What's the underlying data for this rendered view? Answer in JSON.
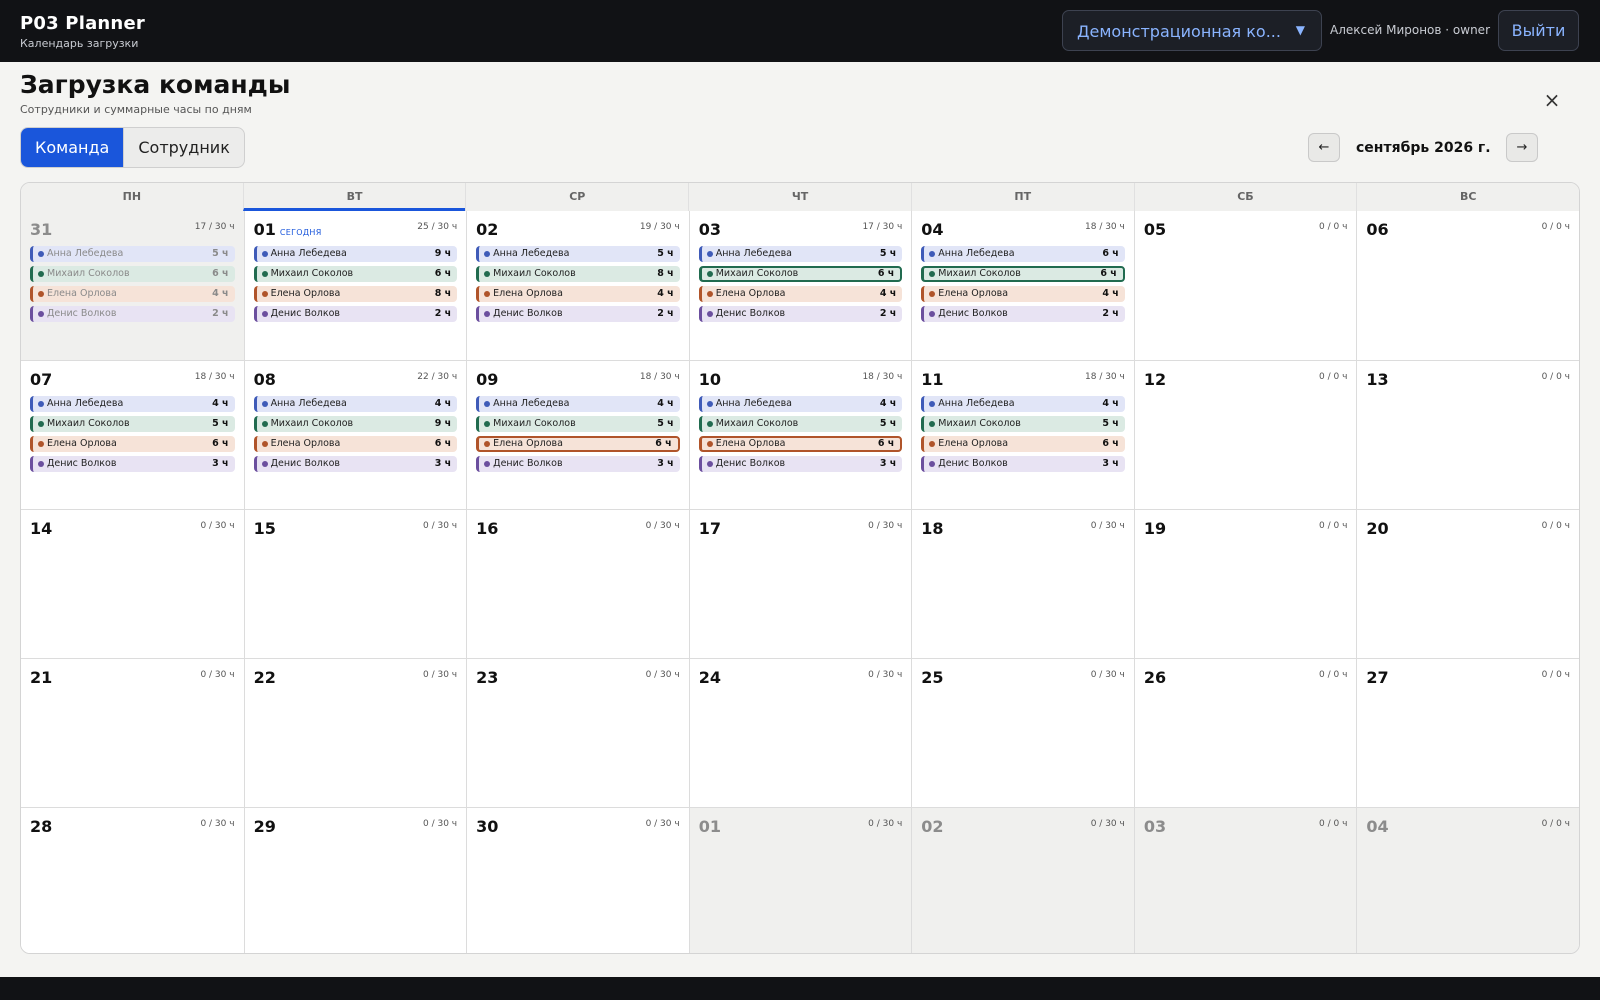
{
  "app": {
    "title": "P03 Planner",
    "subtitle": "Календарь загрузки"
  },
  "header": {
    "team_select": "Демонстрационная ко...",
    "user": "Алексей Миронов · owner",
    "logout": "Выйти"
  },
  "page": {
    "title": "Загрузка команды",
    "subtitle": "Сотрудники и суммарные часы по дням",
    "close": "×"
  },
  "view_toggle": [
    "Команда",
    "Сотрудник"
  ],
  "nav": {
    "prev": "←",
    "next": "→",
    "month": "сентябрь 2026 г."
  },
  "weekdays": [
    "ПН",
    "ВТ",
    "СР",
    "ЧТ",
    "ПТ",
    "СБ",
    "ВС"
  ],
  "today_label": "СЕГОДНЯ",
  "colors": {
    "accent": "#1a56db",
    "anna": "#3f5bb8",
    "mikhail": "#216b4f",
    "elena": "#b0542a",
    "denis": "#6b4f9e"
  },
  "people": [
    "Анна Лебедева",
    "Михаил Соколов",
    "Елена Орлова",
    "Денис Волков"
  ],
  "days": [
    {
      "num": "31",
      "hours": "17 / 30 ч",
      "out": true,
      "a": [
        {
          "p": 0,
          "h": "5 ч"
        },
        {
          "p": 1,
          "h": "6 ч"
        },
        {
          "p": 2,
          "h": "4 ч"
        },
        {
          "p": 3,
          "h": "2 ч"
        }
      ]
    },
    {
      "num": "01",
      "hours": "25 / 30 ч",
      "today": true,
      "a": [
        {
          "p": 0,
          "h": "9 ч"
        },
        {
          "p": 1,
          "h": "6 ч"
        },
        {
          "p": 2,
          "h": "8 ч"
        },
        {
          "p": 3,
          "h": "2 ч"
        }
      ]
    },
    {
      "num": "02",
      "hours": "19 / 30 ч",
      "a": [
        {
          "p": 0,
          "h": "5 ч"
        },
        {
          "p": 1,
          "h": "8 ч"
        },
        {
          "p": 2,
          "h": "4 ч"
        },
        {
          "p": 3,
          "h": "2 ч"
        }
      ]
    },
    {
      "num": "03",
      "hours": "17 / 30 ч",
      "a": [
        {
          "p": 0,
          "h": "5 ч"
        },
        {
          "p": 1,
          "h": "6 ч",
          "hl": true
        },
        {
          "p": 2,
          "h": "4 ч"
        },
        {
          "p": 3,
          "h": "2 ч"
        }
      ]
    },
    {
      "num": "04",
      "hours": "18 / 30 ч",
      "a": [
        {
          "p": 0,
          "h": "6 ч"
        },
        {
          "p": 1,
          "h": "6 ч",
          "hl": true
        },
        {
          "p": 2,
          "h": "4 ч"
        },
        {
          "p": 3,
          "h": "2 ч"
        }
      ]
    },
    {
      "num": "05",
      "hours": "0 / 0 ч",
      "a": []
    },
    {
      "num": "06",
      "hours": "0 / 0 ч",
      "a": []
    },
    {
      "num": "07",
      "hours": "18 / 30 ч",
      "a": [
        {
          "p": 0,
          "h": "4 ч"
        },
        {
          "p": 1,
          "h": "5 ч"
        },
        {
          "p": 2,
          "h": "6 ч"
        },
        {
          "p": 3,
          "h": "3 ч"
        }
      ]
    },
    {
      "num": "08",
      "hours": "22 / 30 ч",
      "a": [
        {
          "p": 0,
          "h": "4 ч"
        },
        {
          "p": 1,
          "h": "9 ч"
        },
        {
          "p": 2,
          "h": "6 ч"
        },
        {
          "p": 3,
          "h": "3 ч"
        }
      ]
    },
    {
      "num": "09",
      "hours": "18 / 30 ч",
      "a": [
        {
          "p": 0,
          "h": "4 ч"
        },
        {
          "p": 1,
          "h": "5 ч"
        },
        {
          "p": 2,
          "h": "6 ч",
          "hl": true
        },
        {
          "p": 3,
          "h": "3 ч"
        }
      ]
    },
    {
      "num": "10",
      "hours": "18 / 30 ч",
      "a": [
        {
          "p": 0,
          "h": "4 ч"
        },
        {
          "p": 1,
          "h": "5 ч"
        },
        {
          "p": 2,
          "h": "6 ч",
          "hl": true
        },
        {
          "p": 3,
          "h": "3 ч"
        }
      ]
    },
    {
      "num": "11",
      "hours": "18 / 30 ч",
      "a": [
        {
          "p": 0,
          "h": "4 ч"
        },
        {
          "p": 1,
          "h": "5 ч"
        },
        {
          "p": 2,
          "h": "6 ч"
        },
        {
          "p": 3,
          "h": "3 ч"
        }
      ]
    },
    {
      "num": "12",
      "hours": "0 / 0 ч",
      "a": []
    },
    {
      "num": "13",
      "hours": "0 / 0 ч",
      "a": []
    },
    {
      "num": "14",
      "hours": "0 / 30 ч",
      "a": []
    },
    {
      "num": "15",
      "hours": "0 / 30 ч",
      "a": []
    },
    {
      "num": "16",
      "hours": "0 / 30 ч",
      "a": []
    },
    {
      "num": "17",
      "hours": "0 / 30 ч",
      "a": []
    },
    {
      "num": "18",
      "hours": "0 / 30 ч",
      "a": []
    },
    {
      "num": "19",
      "hours": "0 / 0 ч",
      "a": []
    },
    {
      "num": "20",
      "hours": "0 / 0 ч",
      "a": []
    },
    {
      "num": "21",
      "hours": "0 / 30 ч",
      "a": []
    },
    {
      "num": "22",
      "hours": "0 / 30 ч",
      "a": []
    },
    {
      "num": "23",
      "hours": "0 / 30 ч",
      "a": []
    },
    {
      "num": "24",
      "hours": "0 / 30 ч",
      "a": []
    },
    {
      "num": "25",
      "hours": "0 / 30 ч",
      "a": []
    },
    {
      "num": "26",
      "hours": "0 / 0 ч",
      "a": []
    },
    {
      "num": "27",
      "hours": "0 / 0 ч",
      "a": []
    },
    {
      "num": "28",
      "hours": "0 / 30 ч",
      "a": []
    },
    {
      "num": "29",
      "hours": "0 / 30 ч",
      "a": []
    },
    {
      "num": "30",
      "hours": "0 / 30 ч",
      "a": []
    },
    {
      "num": "01",
      "hours": "0 / 30 ч",
      "out": true,
      "a": []
    },
    {
      "num": "02",
      "hours": "0 / 30 ч",
      "out": true,
      "a": []
    },
    {
      "num": "03",
      "hours": "0 / 0 ч",
      "out": true,
      "a": []
    },
    {
      "num": "04",
      "hours": "0 / 0 ч",
      "out": true,
      "a": []
    }
  ]
}
